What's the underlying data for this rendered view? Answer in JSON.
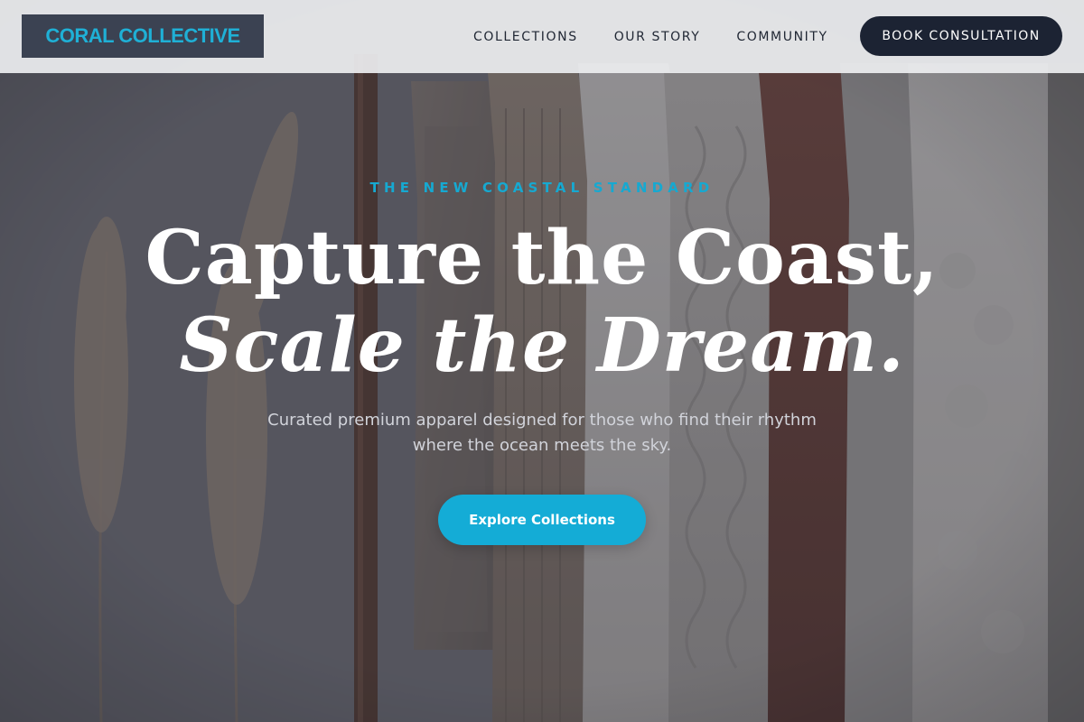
{
  "brand": {
    "name": "CORAL COLLECTIVE",
    "accent_color": "#1fb0d6"
  },
  "nav": {
    "links": [
      "COLLECTIONS",
      "OUR STORY",
      "COMMUNITY"
    ],
    "cta_label": "BOOK CONSULTATION"
  },
  "hero": {
    "eyebrow": "THE NEW COASTAL STANDARD",
    "headline_line1": "Capture the Coast,",
    "headline_line2": "Scale the Dream.",
    "subtitle": "Curated premium apparel designed for those who find their rhythm where the ocean meets the sky.",
    "button_label": "Explore Collections",
    "background_image": "clothing-rack-with-pampas-grass"
  },
  "colors": {
    "header_bg": "#ecedef",
    "dark_navy": "#1c2333",
    "primary_cyan": "#14acd6",
    "text_white": "#ffffff"
  }
}
